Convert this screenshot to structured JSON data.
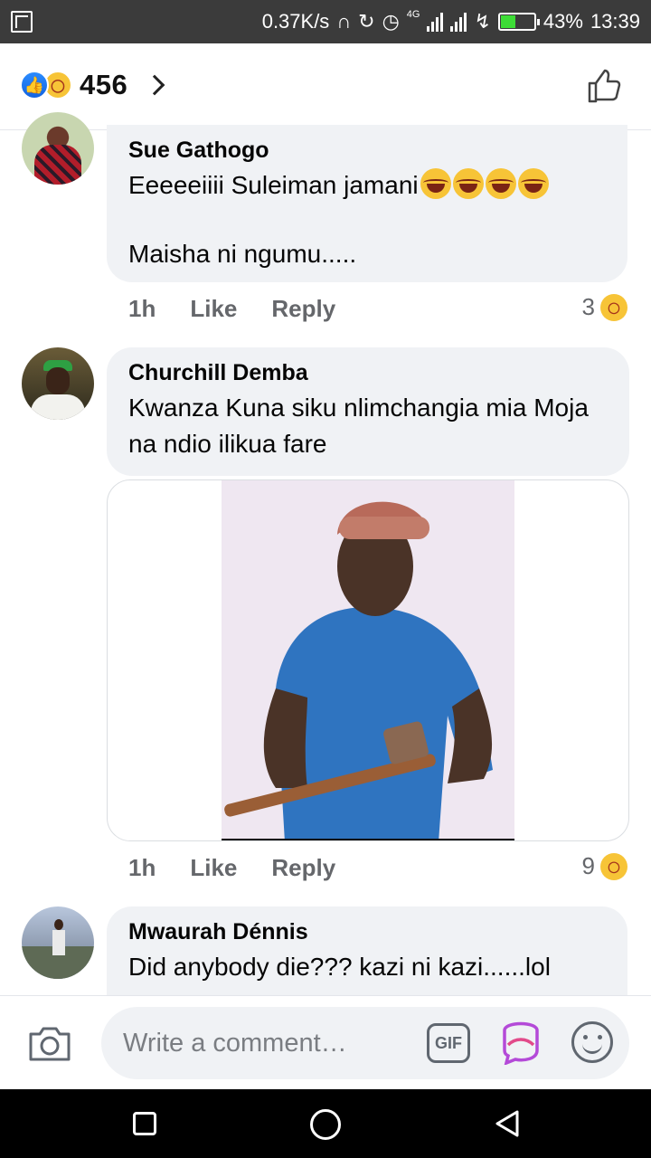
{
  "status_bar": {
    "net_speed": "0.37K/s",
    "network": "4G",
    "battery": "43%",
    "battery_level": 0.43,
    "time": "13:39"
  },
  "header": {
    "reaction_count": "456",
    "reactions": [
      "like",
      "haha"
    ]
  },
  "comments": [
    {
      "author": "Sue Gathogo",
      "line1": "Eeeeeiiii Suleiman jamani",
      "line1_emojis": 4,
      "line2": "Maisha ni ngumu.....",
      "time": "1h",
      "like_label": "Like",
      "reply_label": "Reply",
      "reaction_count": "3",
      "reaction_type": "haha"
    },
    {
      "author": "Churchill Demba",
      "text": "Kwanza Kuna siku nlimchangia mia Moja na ndio ilikua fare",
      "has_image": true,
      "time": "1h",
      "like_label": "Like",
      "reply_label": "Reply",
      "reaction_count": "9",
      "reaction_type": "haha"
    },
    {
      "author": "Mwaurah Dénnis",
      "text": "Did anybody die??? kazi ni kazi......lol"
    }
  ],
  "composer": {
    "placeholder": "Write a comment…",
    "gif_label": "GIF"
  },
  "colors": {
    "bubble": "#f0f2f5",
    "meta_text": "#65676b",
    "like_blue": "#1877f2",
    "haha_yellow": "#f7c437"
  }
}
